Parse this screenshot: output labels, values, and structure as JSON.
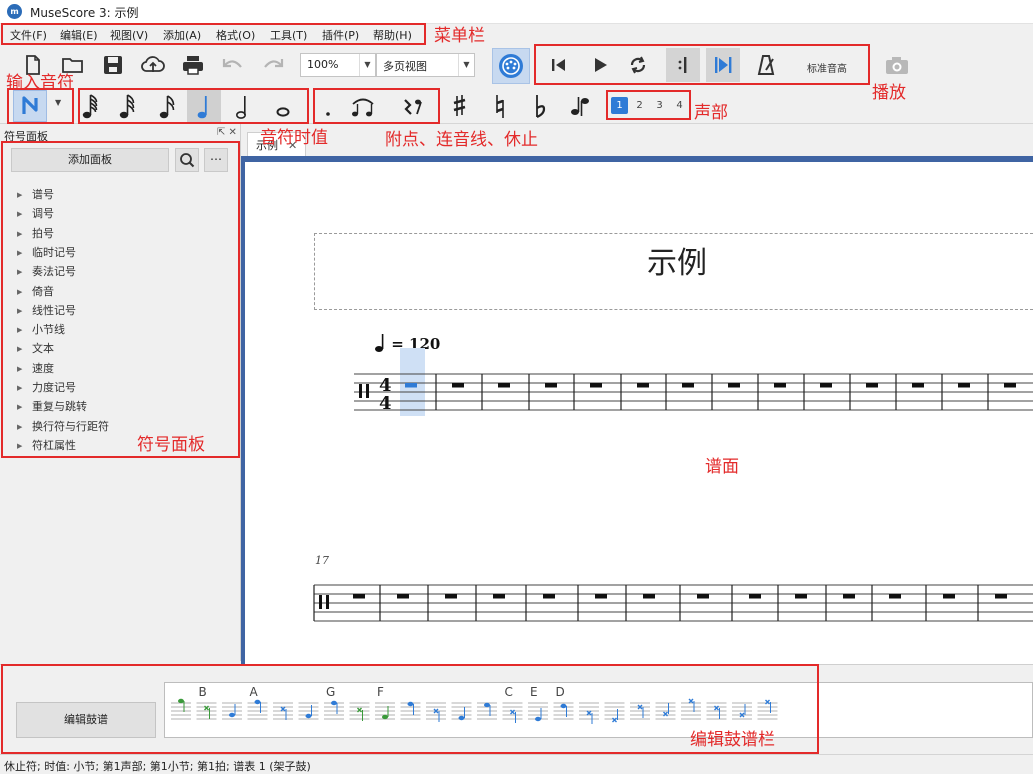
{
  "window": {
    "title": "MuseScore 3: 示例",
    "app_icon": "musescore-logo-icon"
  },
  "menubar": {
    "items": [
      "文件(F)",
      "编辑(E)",
      "视图(V)",
      "添加(A)",
      "格式(O)",
      "工具(T)",
      "插件(P)",
      "帮助(H)"
    ]
  },
  "toolbar": {
    "file_icons": [
      "new-file-icon",
      "open-folder-icon",
      "save-icon",
      "upload-cloud-icon",
      "print-icon",
      "undo-icon",
      "redo-icon"
    ],
    "zoom_value": "100%",
    "view_mode": "多页视图",
    "midi_icon": "midi-input-icon",
    "playback_icons": [
      "rewind-to-start-icon",
      "play-icon",
      "loop-icon",
      "loop-in-icon",
      "loop-out-icon",
      "metronome-icon"
    ],
    "concert_pitch": "标准音高",
    "image_capture_icon": "camera-icon"
  },
  "note_input": {
    "mode_icon": "note-input-icon",
    "durations": [
      "64th-note-icon",
      "32nd-note-icon",
      "16th-note-icon",
      "eighth-note-icon",
      "quarter-note-icon",
      "half-note-icon",
      "whole-note-icon"
    ],
    "selected_duration": "quarter-note-icon",
    "modifiers": [
      "augmentation-dot-icon",
      "tie-icon",
      "rest-icon"
    ],
    "accidentals": [
      "sharp-icon",
      "natural-icon",
      "flat-icon",
      "flip-direction-icon"
    ],
    "voices": [
      "1",
      "2",
      "3",
      "4"
    ],
    "active_voice": "1"
  },
  "palette": {
    "title": "符号面板",
    "add_button": "添加面板",
    "items": [
      "谱号",
      "调号",
      "拍号",
      "临时记号",
      "奏法记号",
      "倚音",
      "线性记号",
      "小节线",
      "文本",
      "速度",
      "力度记号",
      "重复与跳转",
      "换行符与行距符",
      "符杠属性"
    ]
  },
  "score": {
    "tab_label": "示例",
    "title": "示例",
    "tempo": "= 120",
    "time_signature": [
      "4",
      "4"
    ],
    "second_system_measure_number": "17"
  },
  "drumset": {
    "edit_button": "编辑鼓谱",
    "note_letters": [
      "B",
      "A",
      "G",
      "F",
      "C",
      "E",
      "D"
    ]
  },
  "status": "休止符; 时值: 小节; 第1声部; 第1小节; 第1拍; 谱表 1 (架子鼓)",
  "annotations": {
    "menubar": "菜单栏",
    "note_input": "输入音符",
    "durations": "音符时值",
    "modifiers": "附点、连音线、休止",
    "playback": "播放",
    "voices": "声部",
    "palette": "符号面板",
    "score": "谱面",
    "drum_input": "编辑鼓谱栏",
    "color": "#e32a2a"
  }
}
